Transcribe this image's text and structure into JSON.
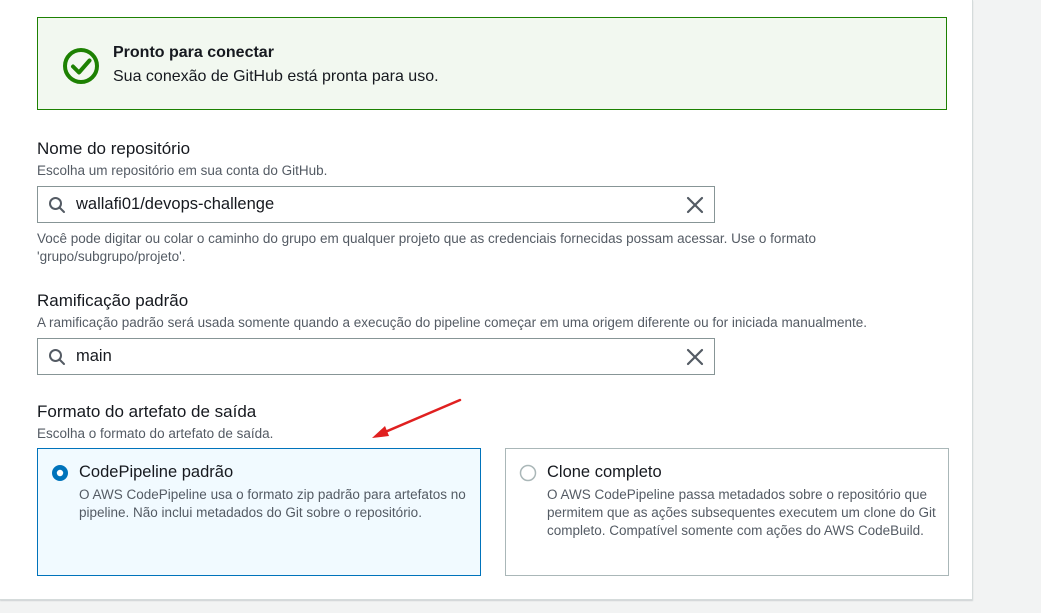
{
  "alert": {
    "title": "Pronto para conectar",
    "message": "Sua conexão de GitHub está pronta para uso.",
    "icon": "check-circle-icon",
    "color": "#1d8102"
  },
  "repository": {
    "label": "Nome do repositório",
    "description": "Escolha um repositório em sua conta do GitHub.",
    "value": "wallafi01/devops-challenge",
    "constraint": "Você pode digitar ou colar o caminho do grupo em qualquer projeto que as credenciais fornecidas possam acessar. Use o formato 'grupo/subgrupo/projeto'."
  },
  "branch": {
    "label": "Ramificação padrão",
    "description": "A ramificação padrão será usada somente quando a execução do pipeline começar em uma origem diferente ou for iniciada manualmente.",
    "value": "main"
  },
  "artifact": {
    "label": "Formato do artefato de saída",
    "description": "Escolha o formato do artefato de saída.",
    "options": [
      {
        "title": "CodePipeline padrão",
        "description": "O AWS CodePipeline usa o formato zip padrão para artefatos no pipeline. Não inclui metadados do Git sobre o repositório.",
        "selected": true
      },
      {
        "title": "Clone completo",
        "description": "O AWS CodePipeline passa metadados sobre o repositório que permitem que as ações subsequentes executem um clone do Git completo. Compatível somente com ações do AWS CodeBuild.",
        "selected": false
      }
    ]
  },
  "colors": {
    "accent": "#0073bb",
    "success": "#1d8102",
    "annotation_arrow": "#e02020"
  }
}
